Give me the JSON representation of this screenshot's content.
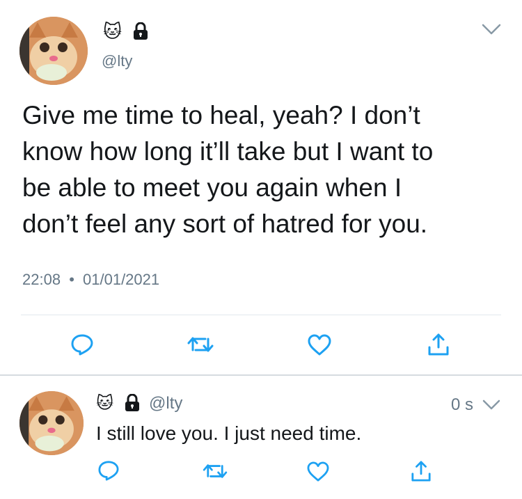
{
  "main_tweet": {
    "name_emoji": "🐱",
    "handle": "@lty",
    "text_lines": [
      "Give me time to heal, yeah? I don’t",
      "know how long it’ll take but I want to",
      "be able to meet you again when I",
      "don’t feel any sort of hatred for you."
    ],
    "time": "22:08",
    "separator": "•",
    "date": "01/01/2021"
  },
  "reply": {
    "name_emoji": "🐱",
    "handle": "@lty",
    "age": "0 s",
    "text": "I still love you. I just need time."
  },
  "colors": {
    "text": "#14171a",
    "muted": "#657786",
    "icon": "#1da1f2",
    "divider": "#e1e8ed"
  }
}
